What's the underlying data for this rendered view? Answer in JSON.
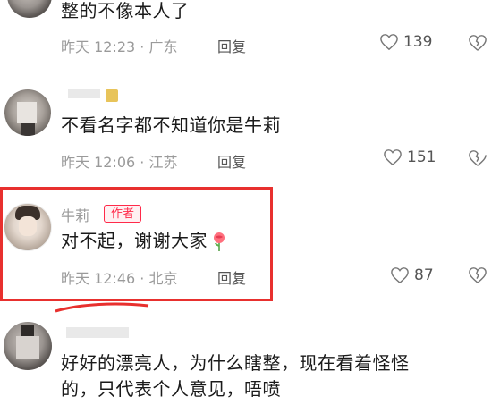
{
  "comments": [
    {
      "text": "整的不像本人了",
      "time": "昨天 12:23",
      "location": "广东",
      "reply_label": "回复",
      "likes": "139"
    },
    {
      "text": "不看名字都不知道你是牛莉",
      "time": "昨天 12:06",
      "location": "江苏",
      "reply_label": "回复",
      "likes": "151"
    },
    {
      "name": "牛莉",
      "badge": "作者",
      "text": "对不起，谢谢大家",
      "time": "昨天 12:46",
      "location": "北京",
      "reply_label": "回复",
      "likes": "87"
    },
    {
      "text_line1": "好好的漂亮人，为什么瞎整，现在看着怪怪",
      "text_line2": "的，只代表个人意见，唔喷"
    }
  ],
  "separator": "·",
  "colors": {
    "highlight_border": "#e8302e",
    "author_badge": "#ff2a4a",
    "meta_text": "#9a9a9a"
  },
  "icons": [
    "heart-icon",
    "broken-heart-icon",
    "rose-emoji"
  ]
}
